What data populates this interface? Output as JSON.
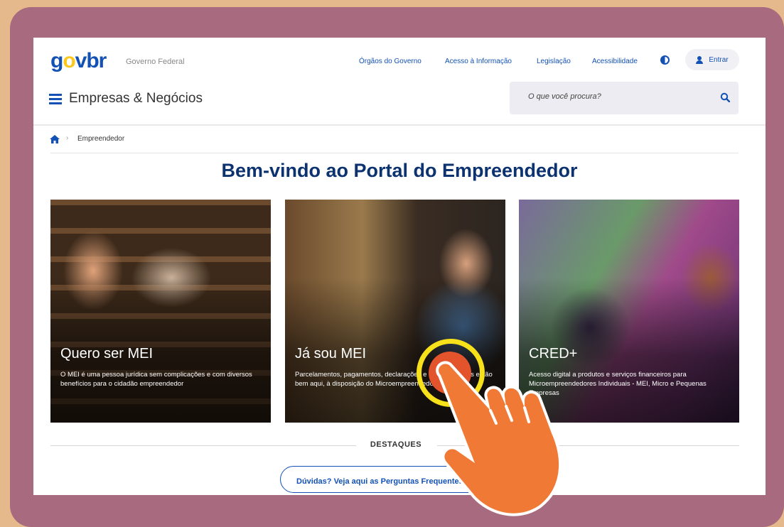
{
  "header": {
    "logo": {
      "g": "g",
      "o": "o",
      "v": "v",
      "dot": ".",
      "br": "br"
    },
    "subtitle": "Governo Federal",
    "links": [
      "Órgãos do Governo",
      "Acesso à Informação",
      "Legislação",
      "Acessibilidade"
    ],
    "login_label": "Entrar",
    "site_title": "Empresas & Negócios",
    "search_placeholder": "O que você procura?"
  },
  "breadcrumb": {
    "current": "Empreendedor",
    "separator": "›"
  },
  "page_title": "Bem-vindo ao Portal do Empreendedor",
  "cards": [
    {
      "title": "Quero ser MEI",
      "desc": "O MEI é uma pessoa jurídica sem complicações e com diversos benefícios para o cidadão empreendedor"
    },
    {
      "title": "Já sou MEI",
      "desc": "Parcelamentos, pagamentos, declarações e outros serviços estão bem aqui, à disposição do Microempreendedor"
    },
    {
      "title": "CRED+",
      "desc": "Acesso digital a produtos e serviços financeiros para Microempreendedores Individuais - MEI, Micro e Pequenas Empresas"
    }
  ],
  "destaques_label": "DESTAQUES",
  "faq_label": "Dúvidas? Veja aqui as Perguntas Frequentes",
  "colors": {
    "brand_blue": "#1351b4",
    "title_blue": "#0c326f",
    "frame": "#a86a7f",
    "outer": "#e6b98c",
    "ring": "#f7e11a",
    "hand": "#f07a35"
  },
  "icons": [
    "menu-icon",
    "search-icon",
    "home-icon",
    "contrast-icon",
    "user-icon",
    "pointing-hand-icon"
  ]
}
